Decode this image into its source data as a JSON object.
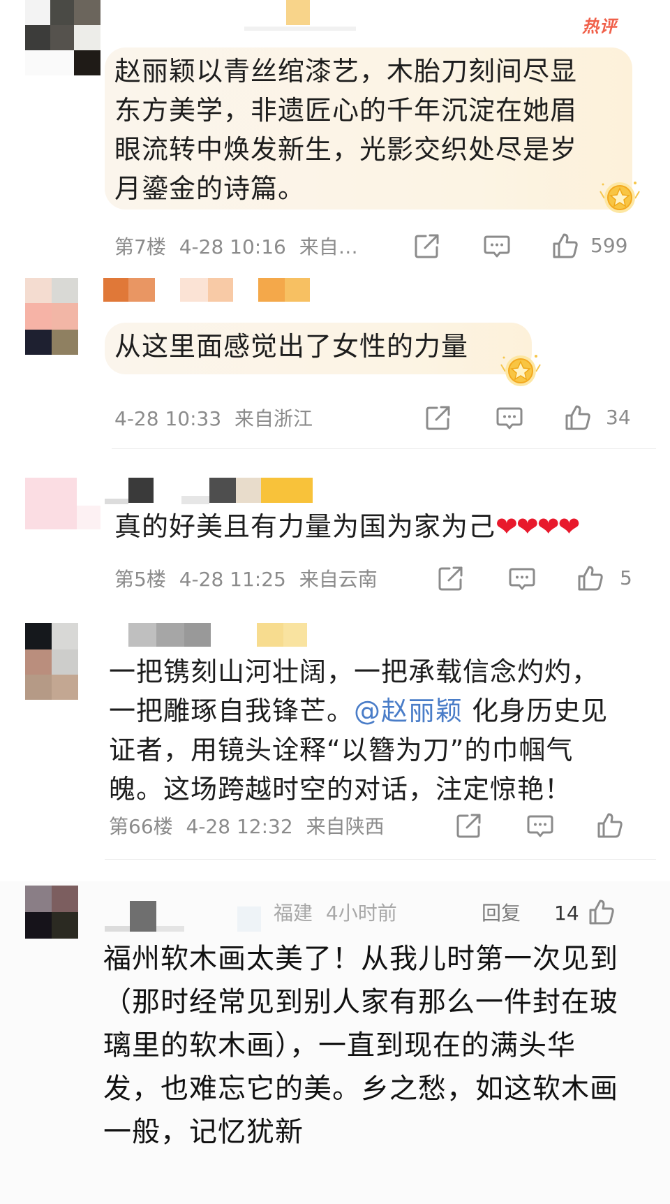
{
  "badge": {
    "hot_label": "热评"
  },
  "comments": [
    {
      "text": "赵丽颖以青丝绾漆艺，木胎刀刻间尽显东方美学，非遗匠心的千年沉淀在她眉眼流转中焕发新生，光影交织处尽是岁月鎏金的诗篇。",
      "floor": "第7楼",
      "time": "4-28 10:16",
      "location": "来自…",
      "likes": "599"
    },
    {
      "text": "从这里面感觉出了女性的力量",
      "time": "4-28 10:33",
      "location": "来自浙江",
      "likes": "34"
    },
    {
      "text": "真的好美且有力量为国为家为己",
      "emoji": "❤❤❤❤",
      "floor": "第5楼",
      "time": "4-28 11:25",
      "location": "来自云南",
      "likes": "5"
    },
    {
      "text_before": "一把镌刻山河壮阔，一把承载信念灼灼，一把雕琢自我锋芒。",
      "mention": "@赵丽颖",
      "text_after": " 化身历史见证者，用镜头诠释“以簪为刀”的巾帼气魄。这场跨越时空的对话，注定惊艳！",
      "floor": "第66楼",
      "time": "4-28 12:32",
      "location": "来自陕西"
    },
    {
      "location": "福建",
      "relative_time": "4小时前",
      "reply_label": "回复",
      "likes": "14",
      "text": "福州软木画太美了！从我儿时第一次见到（那时经常见到别人家有那么一件封在玻璃里的软木画），一直到现在的满头华发，也难忘它的美。乡之愁，如这软木画一般，记忆犹新"
    }
  ],
  "icons": {
    "share": "share-icon",
    "comment": "comment-icon",
    "like": "thumbs-up-icon",
    "medal": "fan-medal-icon"
  },
  "colors": {
    "bubble": "#fcf4e4",
    "hot": "#f0604a",
    "mention": "#4a7dc8",
    "meta": "#8b8b8b",
    "text": "#1d1d1d"
  }
}
